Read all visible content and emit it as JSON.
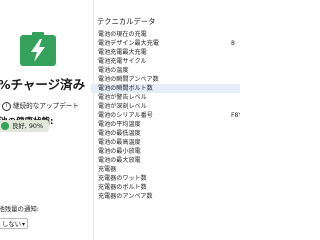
{
  "status": {
    "headline": "%チャージ済み",
    "adaptive_label": "継続的なアップデート",
    "health_label": "池の健康状態:",
    "health_value": "良好, 90%",
    "colors": {
      "battery_green": "#35a25b",
      "health_bg": "#e1e7d9",
      "selected_row": "#e4edf9"
    }
  },
  "notifications": {
    "label": "電池残量の通知:",
    "selected": "しない"
  },
  "technical": {
    "title": "テクニカルデータ",
    "rows": [
      {
        "label": "電池の現在の充電",
        "value": ""
      },
      {
        "label": "電池デザイン最大充電",
        "value": "8"
      },
      {
        "label": "電池充電最大充電",
        "value": ""
      },
      {
        "label": "電池充電サイクル",
        "value": ""
      },
      {
        "label": "電池の温度",
        "value": ""
      },
      {
        "label": "電池の瞬間アンペア数",
        "value": ""
      },
      {
        "label": "電池の瞬間ボルト数",
        "value": ""
      },
      {
        "label": "電池が警告レベル",
        "value": ""
      },
      {
        "label": "電池が深刻レベル",
        "value": ""
      },
      {
        "label": "電池のシリアル番号",
        "value": "F8Y"
      },
      {
        "label": "電池の平均温度",
        "value": ""
      },
      {
        "label": "電池の最低温度",
        "value": ""
      },
      {
        "label": "電池の最高温度",
        "value": ""
      },
      {
        "label": "電池の最小放電",
        "value": ""
      },
      {
        "label": "電池の最大放電",
        "value": ""
      },
      {
        "label": "充電器",
        "value": ""
      },
      {
        "label": "充電器のワット数",
        "value": ""
      },
      {
        "label": "充電器のボルト数",
        "value": ""
      },
      {
        "label": "充電器のアンペア数",
        "value": ""
      }
    ],
    "selected_index": 6
  }
}
